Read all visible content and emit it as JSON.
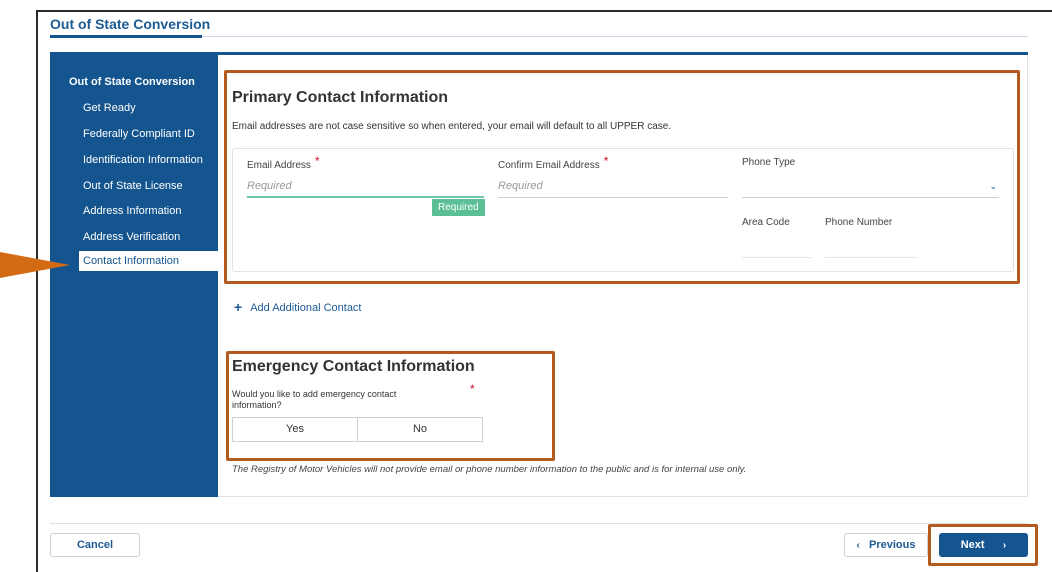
{
  "page": {
    "title": "Out of State Conversion"
  },
  "sidebar": {
    "heading": "Out of State Conversion",
    "items": [
      {
        "label": "Get Ready"
      },
      {
        "label": "Federally Compliant ID"
      },
      {
        "label": "Identification Information"
      },
      {
        "label": "Out of State License"
      },
      {
        "label": "Address Information"
      },
      {
        "label": "Address Verification"
      },
      {
        "label": "Contact Information",
        "active": true
      }
    ]
  },
  "primary_contact": {
    "title": "Primary Contact Information",
    "helper": "Email addresses are not case sensitive so when entered, your email will default to all UPPER case.",
    "email_label": "Email Address",
    "email_placeholder": "Required",
    "email_error": "Required",
    "confirm_label": "Confirm Email Address",
    "confirm_placeholder": "Required",
    "phone_type_label": "Phone Type",
    "area_code_label": "Area Code",
    "phone_number_label": "Phone Number",
    "required_marker": "*"
  },
  "add_contact": {
    "icon": "+",
    "label": "Add Additional Contact"
  },
  "emergency_contact": {
    "title": "Emergency Contact Information",
    "question": "Would you like to add emergency contact information?",
    "required_marker": "*",
    "options": [
      "Yes",
      "No"
    ]
  },
  "disclaimer": "The Registry of Motor Vehicles will not provide email or phone number information to the public and is for internal use only.",
  "footer": {
    "cancel_label": "Cancel",
    "previous_label": "Previous",
    "previous_icon": "‹",
    "next_label": "Next",
    "next_icon": "›"
  },
  "colors": {
    "brand_blue": "#14558f",
    "highlight_orange": "#b45a1f",
    "arrow_orange": "#d36a14",
    "error_green": "#5bbf95",
    "required_red": "#c8102e"
  }
}
